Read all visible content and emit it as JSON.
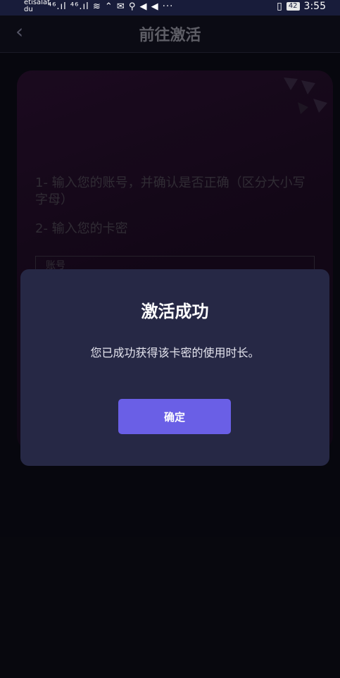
{
  "status_bar": {
    "carrier_top": "etisalat",
    "carrier_bottom": "du",
    "signal_icons": "⁴⁶.ıl ⁴⁶.ıl ≋ ⌃ ✉ ⚲ ◀ ◀ ···",
    "vibrate_icon": "▯",
    "battery": "42",
    "time": "3:55"
  },
  "header": {
    "back_icon": "‹",
    "title": "前往激活"
  },
  "background_card": {
    "step1": "1- 输入您的账号，并确认是否正确（区分大小写字母）",
    "step2": "2- 输入您的卡密",
    "input_placeholder": "账号"
  },
  "dialog": {
    "title": "激活成功",
    "message": "您已成功获得该卡密的使用时长。",
    "confirm_label": "确定"
  },
  "colors": {
    "accent": "#6a5fe6",
    "dialog_bg": "#262845",
    "page_bg": "#0c0c16"
  }
}
